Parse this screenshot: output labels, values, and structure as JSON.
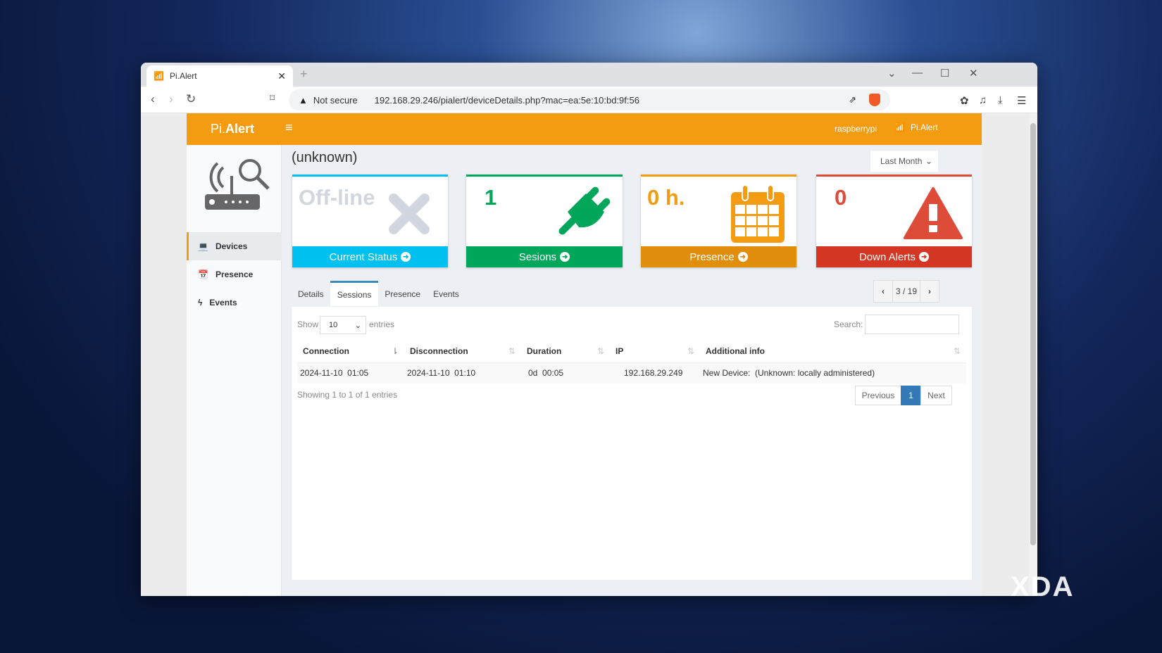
{
  "browser": {
    "tab_title": "Pi.Alert",
    "security": "Not secure",
    "url": "192.168.29.246/pialert/deviceDetails.php?mac=ea:5e:10:bd:9f:56"
  },
  "header": {
    "logo_a": "Pi.",
    "logo_b": "Alert",
    "host": "raspberrypi",
    "brand": "Pi.Alert"
  },
  "sidebar": {
    "items": [
      {
        "label": "Devices"
      },
      {
        "label": "Presence"
      },
      {
        "label": "Events"
      }
    ]
  },
  "device": {
    "title": "(unknown)",
    "period": "Last Month"
  },
  "cards": [
    {
      "value": "Off-line",
      "label": "Current Status",
      "color": "#00c0ef"
    },
    {
      "value": "1",
      "label": "Sesions",
      "color": "#00a65a"
    },
    {
      "value": "0 h.",
      "label": "Presence",
      "color": "#f39c12"
    },
    {
      "value": "0",
      "label": "Down Alerts",
      "color": "#dd4b39"
    }
  ],
  "tabs": [
    "Details",
    "Sessions",
    "Presence",
    "Events"
  ],
  "nav": {
    "position": "3 / 19"
  },
  "table": {
    "show": "Show",
    "entries_value": "10",
    "entries": "entries",
    "search": "Search:",
    "columns": [
      "Connection",
      "Disconnection",
      "Duration",
      "IP",
      "Additional info"
    ],
    "rows": [
      [
        "2024-11-10  01:05",
        "2024-11-10  01:10",
        "0d  00:05",
        "192.168.29.249",
        "New Device:  (Unknown: locally administered)"
      ]
    ],
    "info": "Showing 1 to 1 of 1 entries",
    "prev": "Previous",
    "page": "1",
    "next": "Next"
  },
  "watermark": "XDA"
}
